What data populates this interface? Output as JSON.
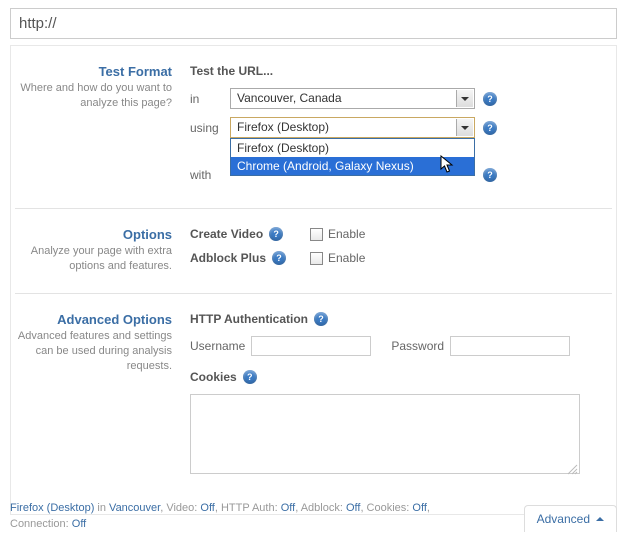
{
  "url_value": "http://",
  "test_format": {
    "title": "Test Format",
    "desc": "Where and how do you want to analyze this page?",
    "heading": "Test the URL...",
    "rows": {
      "in_label": "in",
      "using_label": "using",
      "with_label": "with"
    },
    "location_selected": "Vancouver, Canada",
    "browser_selected": "Firefox (Desktop)",
    "browser_options": [
      "Firefox (Desktop)",
      "Chrome (Android, Galaxy Nexus)"
    ]
  },
  "options_section": {
    "title": "Options",
    "desc": "Analyze your page with extra options and features.",
    "create_video": "Create Video",
    "adblock": "Adblock Plus",
    "enable": "Enable"
  },
  "advanced_section": {
    "title": "Advanced Options",
    "desc": "Advanced features and settings can be used during analysis requests.",
    "http_auth": "HTTP Authentication",
    "username": "Username",
    "password": "Password",
    "cookies": "Cookies"
  },
  "footer": {
    "browser": "Firefox (Desktop)",
    "in_word": " in ",
    "location": "Vancouver",
    "video_lbl": ", Video: ",
    "video_val": "Off",
    "http_lbl": ", HTTP Auth: ",
    "http_val": "Off",
    "adblock_lbl": ", Adblock: ",
    "adblock_val": "Off",
    "cookies_lbl": ", Cookies: ",
    "cookies_val": "Off",
    "conn_lbl": "Connection: ",
    "conn_val": "Off",
    "advanced_button": "Advanced"
  }
}
